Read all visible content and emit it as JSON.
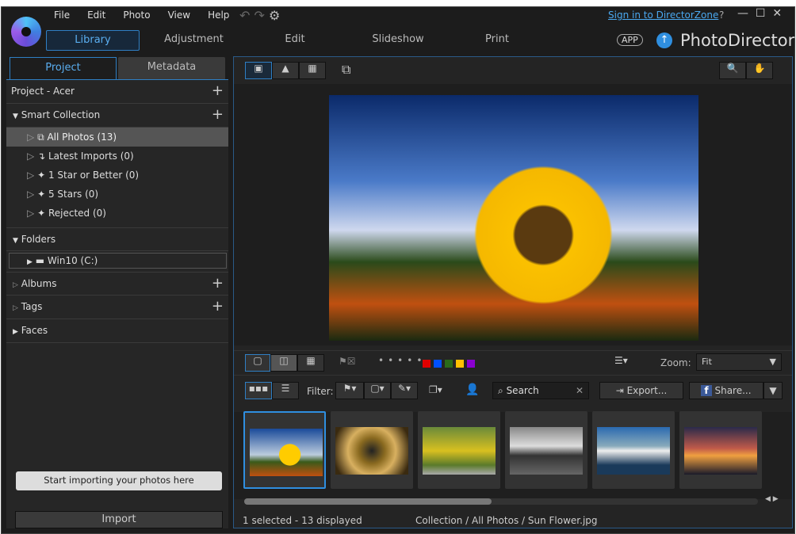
{
  "menu": [
    "File",
    "Edit",
    "Photo",
    "View",
    "Help"
  ],
  "signin": "Sign in to DirectorZone",
  "help": "?",
  "tabs": [
    "Library",
    "Adjustment",
    "Edit",
    "Slideshow",
    "Print"
  ],
  "app_badge": "APP",
  "brand": "PhotoDirector",
  "panel_tabs": [
    "Project",
    "Metadata"
  ],
  "project_title": "Project - Acer",
  "smart_collection": "Smart Collection",
  "smart_items": [
    "All Photos (13)",
    "Latest Imports (0)",
    "1 Star or Better (0)",
    "5 Stars (0)",
    "Rejected (0)"
  ],
  "folders": "Folders",
  "folder_item": "Win10 (C:)",
  "albums": "Albums",
  "tags": "Tags",
  "faces": "Faces",
  "import_tip": "Start importing your photos here",
  "import_button": "Import",
  "zoom_label": "Zoom:",
  "zoom_value": "Fit",
  "filter_label": "Filter:",
  "search_placeholder": "Search",
  "export": "Export...",
  "share": "Share...",
  "label_colors": [
    "#e00000",
    "#0050ff",
    "#2a6a1a",
    "#ffc000",
    "#8a00d0"
  ],
  "status": "1 selected - 13 displayed",
  "path": "Collection / All Photos / Sun Flower.jpg",
  "accent": "#2f8fe0"
}
